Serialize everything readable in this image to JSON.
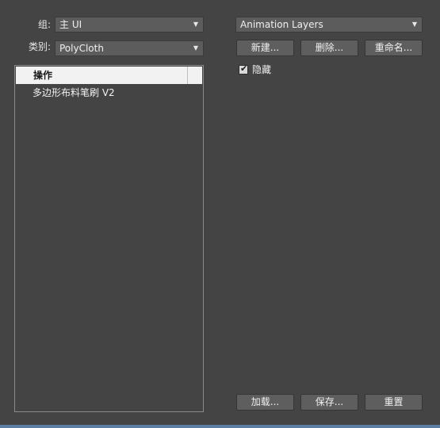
{
  "left": {
    "group_label": "组:",
    "group_value": "主 UI",
    "category_label": "类别:",
    "category_value": "PolyCloth",
    "list_header": "操作",
    "list_items": [
      "多边形布料笔刷 V2"
    ]
  },
  "right": {
    "layer_dropdown": "Animation Layers",
    "new_button": "新建...",
    "delete_button": "删除...",
    "rename_button": "重命名...",
    "hide_checkbox_label": "隐藏",
    "hide_checked": true,
    "load_button": "加载...",
    "save_button": "保存...",
    "reset_button": "重置"
  },
  "colors": {
    "background": "#444444",
    "accent": "#5d7ea3"
  }
}
